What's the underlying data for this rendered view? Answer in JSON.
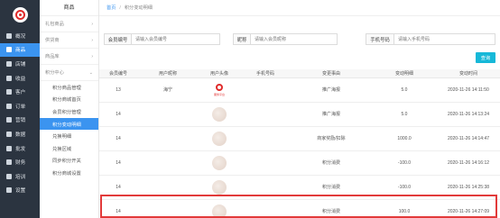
{
  "sidebar": {
    "items": [
      {
        "label": "概况",
        "icon": "overview-icon",
        "active": false
      },
      {
        "label": "商品",
        "icon": "goods-icon",
        "active": true
      },
      {
        "label": "店铺",
        "icon": "store-icon",
        "active": false
      },
      {
        "label": "收益",
        "icon": "income-icon",
        "active": false
      },
      {
        "label": "客户",
        "icon": "customer-icon",
        "active": false
      },
      {
        "label": "订单",
        "icon": "order-icon",
        "active": false
      },
      {
        "label": "营销",
        "icon": "marketing-icon",
        "active": false
      },
      {
        "label": "数据",
        "icon": "data-icon",
        "active": false
      },
      {
        "label": "批发",
        "icon": "wholesale-icon",
        "active": false
      },
      {
        "label": "财务",
        "icon": "finance-icon",
        "active": false
      },
      {
        "label": "培训",
        "icon": "training-icon",
        "active": false
      },
      {
        "label": "设置",
        "icon": "settings-icon",
        "active": false
      }
    ]
  },
  "submenu": {
    "title": "商品",
    "groups": [
      {
        "label": "礼包商品"
      },
      {
        "label": "供货商"
      },
      {
        "label": "商品库"
      },
      {
        "label": "积分中心"
      }
    ],
    "items": [
      {
        "label": "积分商品管理",
        "active": false
      },
      {
        "label": "积分商城首页",
        "active": false
      },
      {
        "label": "会员积分管理",
        "active": false
      },
      {
        "label": "积分变动明细",
        "active": true
      },
      {
        "label": "兑换明细",
        "active": false
      },
      {
        "label": "兑换区域",
        "active": false
      },
      {
        "label": "同步积分开关",
        "active": false
      },
      {
        "label": "积分商城设置",
        "active": false
      }
    ]
  },
  "breadcrumb": {
    "home": "首页",
    "separator": "/",
    "current": "积分变动明细"
  },
  "filters": {
    "member_no_label": "会员编号",
    "member_no_placeholder": "请输入会员编号",
    "nickname_label": "昵称",
    "nickname_placeholder": "请输入会员昵称",
    "phone_label": "手机号码",
    "phone_placeholder": "请输入手机号码",
    "search_label": "查询"
  },
  "table": {
    "headers": [
      "会员编号",
      "用户昵称",
      "用户头像",
      "手机号码",
      "变更事由",
      "变动明细",
      "变动时间"
    ],
    "rows": [
      {
        "member_no": "13",
        "nickname": "海宁",
        "avatar": "logo",
        "phone": "",
        "reason": "推广海报",
        "change": "5.0",
        "time": "2020-11-26 14:11:50"
      },
      {
        "member_no": "14",
        "nickname": "",
        "avatar": "photo",
        "phone": "",
        "reason": "推广海报",
        "change": "5.0",
        "time": "2020-11-26 14:13:24"
      },
      {
        "member_no": "14",
        "nickname": "",
        "avatar": "photo",
        "phone": "",
        "reason": "商家奖励/扣除",
        "change": "1000.0",
        "time": "2020-11-26 14:14:47"
      },
      {
        "member_no": "14",
        "nickname": "",
        "avatar": "photo",
        "phone": "",
        "reason": "积分消费",
        "change": "-100.0",
        "time": "2020-11-26 14:16:12"
      },
      {
        "member_no": "14",
        "nickname": "",
        "avatar": "photo",
        "phone": "",
        "reason": "积分消费",
        "change": "-100.0",
        "time": "2020-11-26 14:25:38"
      },
      {
        "member_no": "14",
        "nickname": "",
        "avatar": "photo",
        "phone": "",
        "reason": "积分消费",
        "change": "100.0",
        "time": "2020-11-26 14:27:09"
      }
    ]
  },
  "colors": {
    "sidebar_bg": "#2b3440",
    "accent": "#3b94f0",
    "search_button": "#16b8d8",
    "highlight_border": "#e23a3a"
  }
}
